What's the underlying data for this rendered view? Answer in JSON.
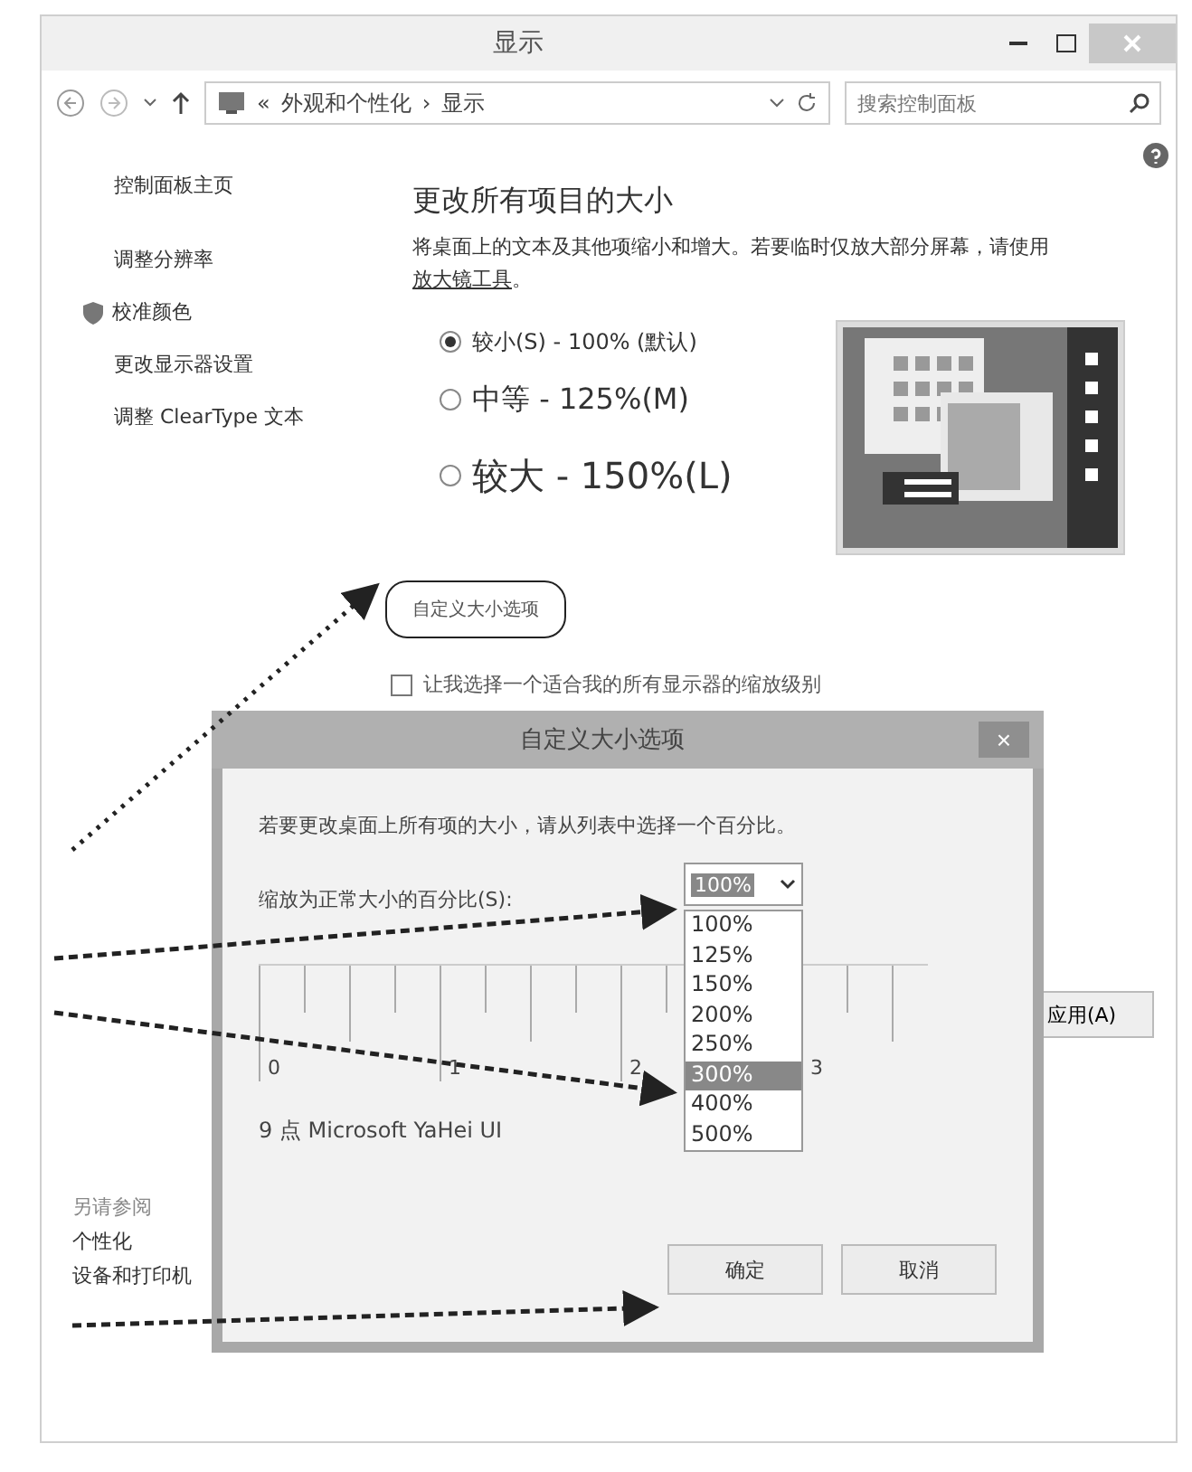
{
  "window": {
    "title": "显示"
  },
  "address": {
    "chevrons": "«",
    "crumbs": [
      "外观和个性化",
      "显示"
    ],
    "separator": "›"
  },
  "search": {
    "placeholder": "搜索控制面板"
  },
  "sidebar": {
    "items": [
      {
        "label": "控制面板主页",
        "kind": "plain"
      },
      {
        "label": "调整分辨率",
        "kind": "plain"
      },
      {
        "label": "校准颜色",
        "kind": "shield"
      },
      {
        "label": "更改显示器设置",
        "kind": "plain"
      },
      {
        "label": "调整 ClearType 文本",
        "kind": "plain"
      }
    ],
    "see_also": {
      "heading": "另请参阅",
      "links": [
        "个性化",
        "设备和打印机"
      ]
    }
  },
  "main": {
    "heading": "更改所有项目的大小",
    "description": "将桌面上的文本及其他项缩小和增大。若要临时仅放大部分屏幕，请使用",
    "link": "放大镜工具",
    "link_end": "。",
    "options": [
      {
        "label": "较小(S) - 100% (默认)",
        "selected": true,
        "kind": "small"
      },
      {
        "label": "中等 - 125%(M)",
        "selected": false,
        "kind": "medium"
      },
      {
        "label": "较大 - 150%(L)",
        "selected": false,
        "kind": "large"
      }
    ],
    "custom_link": "自定义大小选项",
    "checkbox": {
      "label": "让我选择一个适合我的所有显示器的缩放级别",
      "checked": false
    },
    "apply": "应用(A)"
  },
  "dialog": {
    "title": "自定义大小选项",
    "close": "×",
    "description": "若要更改桌面上所有项的大小，请从列表中选择一个百分比。",
    "scale_label": "缩放为正常大小的百分比(S):",
    "combo_value": "100%",
    "options": [
      {
        "label": "100%",
        "selected": false
      },
      {
        "label": "125%",
        "selected": false
      },
      {
        "label": "150%",
        "selected": false
      },
      {
        "label": "200%",
        "selected": false
      },
      {
        "label": "250%",
        "selected": false
      },
      {
        "label": "300%",
        "selected": true
      },
      {
        "label": "400%",
        "selected": false
      },
      {
        "label": "500%",
        "selected": false
      }
    ],
    "ruler_labels": [
      "0",
      "1",
      "2",
      "3"
    ],
    "sample": "9 点 Microsoft YaHei UI",
    "buttons": [
      "确定",
      "取消"
    ]
  }
}
